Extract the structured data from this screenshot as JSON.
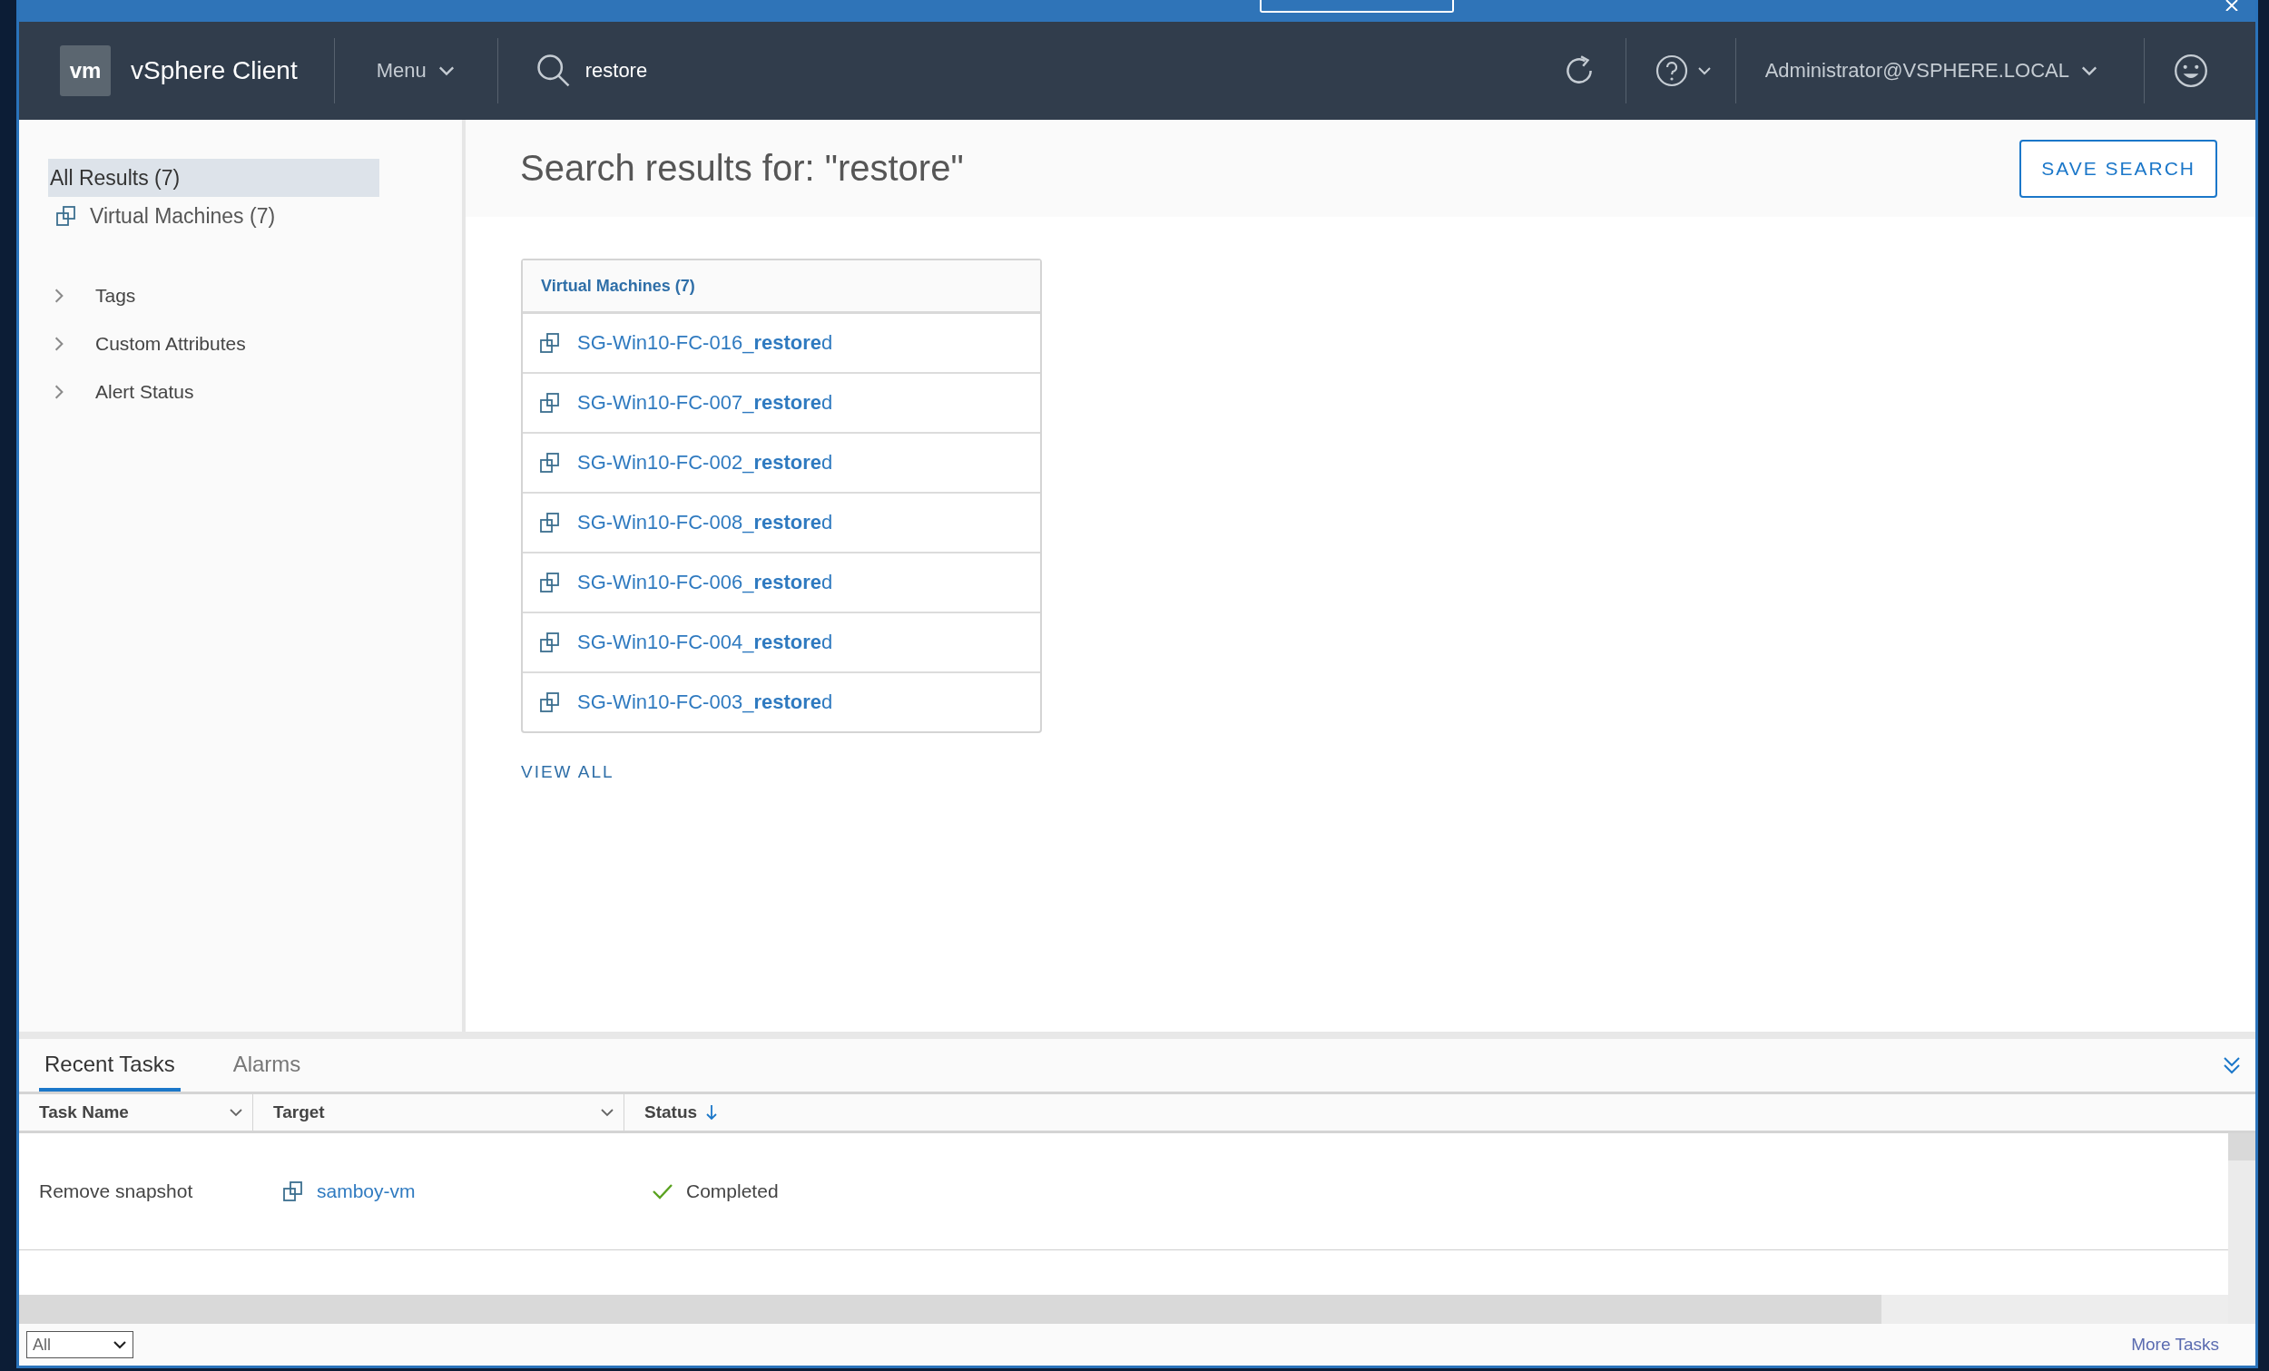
{
  "header": {
    "logo": "vm",
    "product": "vSphere Client",
    "menu": "Menu",
    "search": {
      "value": "restore"
    },
    "user": "Administrator@VSPHERE.LOCAL"
  },
  "sidebar": {
    "items": [
      {
        "label": "All Results (7)",
        "kind": "plain",
        "selected": true
      },
      {
        "label": "Virtual Machines (7)",
        "kind": "vm",
        "selected": false
      }
    ],
    "groups": [
      {
        "label": "Tags",
        "expanded": false
      },
      {
        "label": "Custom Attributes",
        "expanded": false
      },
      {
        "label": "Alert Status",
        "expanded": false
      }
    ]
  },
  "main": {
    "title": "Search results for: \"restore\"",
    "save_button": "SAVE SEARCH",
    "card": {
      "title": "Virtual Machines (7)",
      "rows": [
        "SG-Win10-FC-016_**restore**d",
        "SG-Win10-FC-007_**restore**d",
        "SG-Win10-FC-002_**restore**d",
        "SG-Win10-FC-008_**restore**d",
        "SG-Win10-FC-006_**restore**d",
        "SG-Win10-FC-004_**restore**d",
        "SG-Win10-FC-003_**restore**d"
      ]
    },
    "view_all": "VIEW ALL"
  },
  "tasks": {
    "tabs": [
      {
        "label": "Recent Tasks",
        "selected": true
      },
      {
        "label": "Alarms",
        "selected": false
      }
    ],
    "columns": [
      {
        "label": "Task Name",
        "kind": "filter"
      },
      {
        "label": "Target",
        "kind": "filter"
      },
      {
        "label": "Status",
        "kind": "sort"
      }
    ],
    "rows": [
      {
        "task": "Remove snapshot",
        "target": "samboy-vm",
        "status": "Completed",
        "kind": "completed"
      }
    ],
    "filter": "All",
    "more": "More Tasks"
  }
}
